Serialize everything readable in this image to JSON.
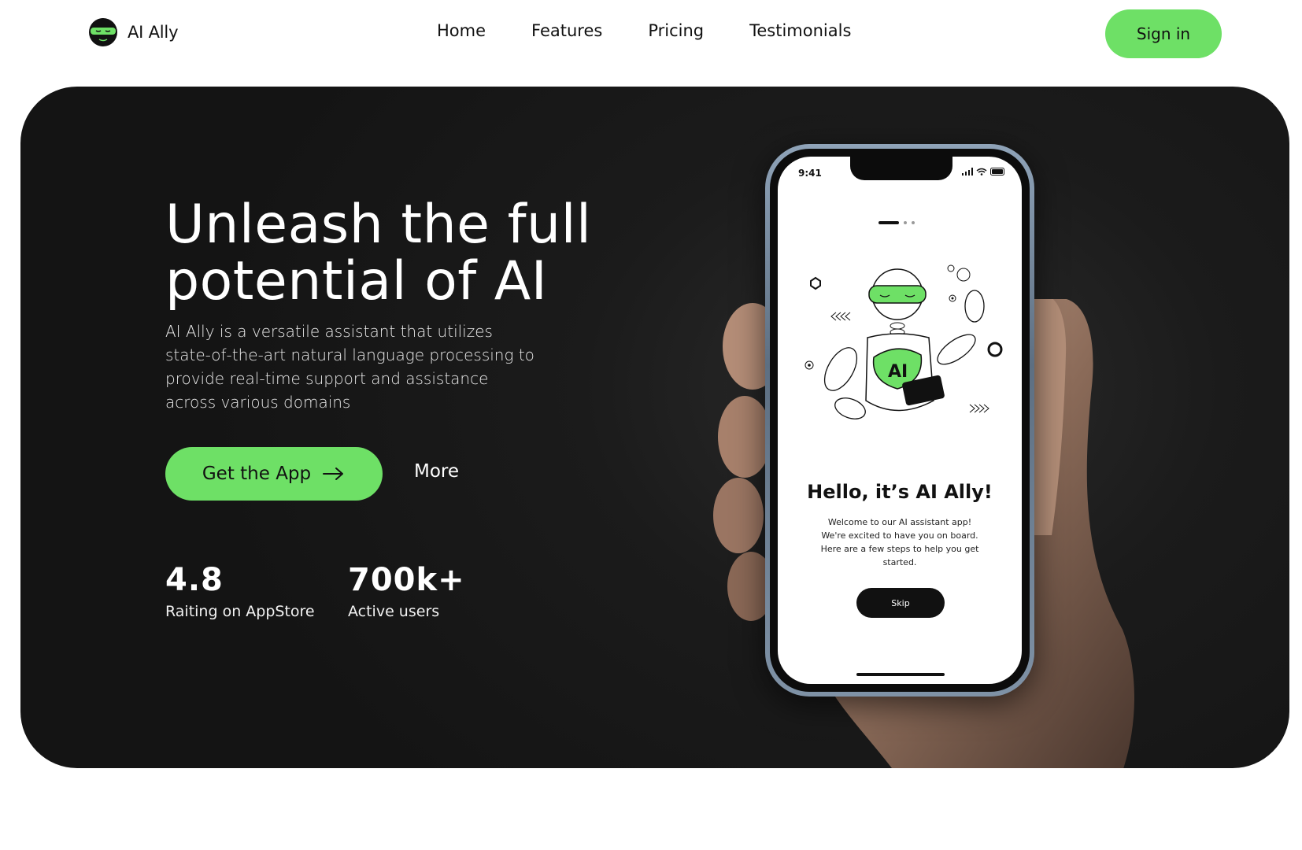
{
  "brand": {
    "name": "AI Ally",
    "logo_icon": "ninja-mask-icon",
    "accent": "#6ee066",
    "dark": "#1b1b1b"
  },
  "nav": {
    "items": [
      {
        "label": "Home"
      },
      {
        "label": "Features"
      },
      {
        "label": "Pricing"
      },
      {
        "label": "Testimonials"
      }
    ]
  },
  "header": {
    "signin_label": "Sign in"
  },
  "hero": {
    "headline_line1": "Unleash the full",
    "headline_line2": "potential of AI",
    "subtitle": "AI Ally is a versatile assistant that utilizes state-of-the-art natural language processing to provide real-time support and assistance across various domains",
    "cta_label": "Get the App",
    "cta_icon": "arrow-right-icon",
    "more_label": "More",
    "stats": [
      {
        "value": "4.8",
        "label": "Raiting on AppStore"
      },
      {
        "value": "700k+",
        "label": "Active users"
      }
    ]
  },
  "phone": {
    "status_time": "9:41",
    "illustration_text": "AI",
    "title": "Hello, it’s AI Ally!",
    "body": "Welcome to our AI assistant app! We're excited to have you on board. Here are a few steps to help you get started.",
    "skip_label": "Skip"
  }
}
